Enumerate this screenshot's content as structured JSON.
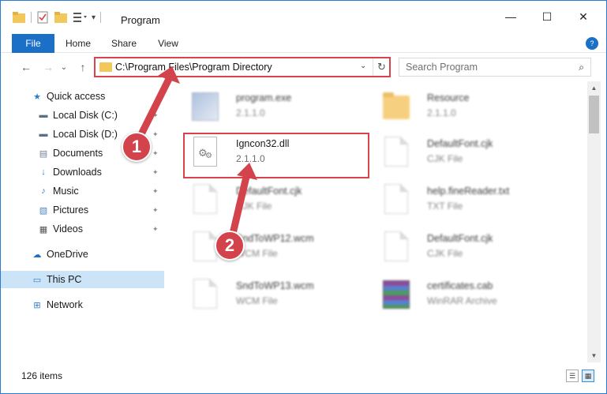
{
  "window": {
    "title": "Program",
    "minimize": "—",
    "maximize": "☐",
    "close": "✕"
  },
  "ribbon": {
    "tabs": [
      "File",
      "Home",
      "Share",
      "View"
    ],
    "toggle": "?"
  },
  "nav": {
    "back": "←",
    "forward": "→",
    "recent": "⌄",
    "up": "↑",
    "address": "C:\\Program Files\\Program Directory",
    "address_dropdown": "⌄",
    "refresh": "↻",
    "search_placeholder": "Search Program",
    "search_icon": "⌕"
  },
  "sidebar": {
    "items": [
      {
        "label": "Quick access",
        "icon": "star-icon",
        "glyph": "★",
        "color": "#2f7bd1"
      },
      {
        "label": "Local Disk (C:)",
        "icon": "drive-icon",
        "glyph": "▬",
        "color": "#5a6f86",
        "pinned": true
      },
      {
        "label": "Local Disk (D:)",
        "icon": "drive-icon",
        "glyph": "▬",
        "color": "#5a6f86",
        "pinned": true
      },
      {
        "label": "Documents",
        "icon": "documents-icon",
        "glyph": "▤",
        "color": "#6f7f93",
        "pinned": true
      },
      {
        "label": "Downloads",
        "icon": "downloads-icon",
        "glyph": "↓",
        "color": "#2f7bd1",
        "pinned": true
      },
      {
        "label": "Music",
        "icon": "music-icon",
        "glyph": "♪",
        "color": "#2f7bd1",
        "pinned": true
      },
      {
        "label": "Pictures",
        "icon": "pictures-icon",
        "glyph": "▧",
        "color": "#4f86b8",
        "pinned": true
      },
      {
        "label": "Videos",
        "icon": "videos-icon",
        "glyph": "▦",
        "color": "#555",
        "pinned": true
      },
      {
        "label": "OneDrive",
        "icon": "onedrive-icon",
        "glyph": "☁",
        "color": "#1f6ec0"
      },
      {
        "label": "This PC",
        "icon": "this-pc-icon",
        "glyph": "▭",
        "color": "#2f7bd1",
        "selected": true
      },
      {
        "label": "Network",
        "icon": "network-icon",
        "glyph": "⊞",
        "color": "#2f7bd1"
      }
    ],
    "pin_glyph": "📌"
  },
  "files": [
    {
      "name": "program.exe",
      "sub": "2.1.1.0",
      "type": "exe",
      "blurred": true
    },
    {
      "name": "Resource",
      "sub": "2.1.1.0",
      "type": "folder",
      "blurred": true
    },
    {
      "name": "Igncon32.dll",
      "sub": "2.1.1.0",
      "type": "dll",
      "blurred": false
    },
    {
      "name": "DefaultFont.cjk",
      "sub": "CJK File",
      "type": "doc",
      "blurred": true
    },
    {
      "name": "DefaultFont.cjk",
      "sub": "CJK File",
      "type": "doc",
      "blurred": true
    },
    {
      "name": "help.fineReader.txt",
      "sub": "TXT File",
      "type": "doc",
      "blurred": true
    },
    {
      "name": "SndToWP12.wcm",
      "sub": "WCM File",
      "type": "doc",
      "blurred": true
    },
    {
      "name": "DefaultFont.cjk",
      "sub": "CJK File",
      "type": "doc",
      "blurred": true
    },
    {
      "name": "SndToWP13.wcm",
      "sub": "WCM File",
      "type": "doc",
      "blurred": true
    },
    {
      "name": "certificates.cab",
      "sub": "WinRAR Archive",
      "type": "rar",
      "blurred": true
    }
  ],
  "status": {
    "item_count": "126 items"
  },
  "annotations": {
    "step1": "1",
    "step2": "2",
    "color": "#d3434c"
  }
}
